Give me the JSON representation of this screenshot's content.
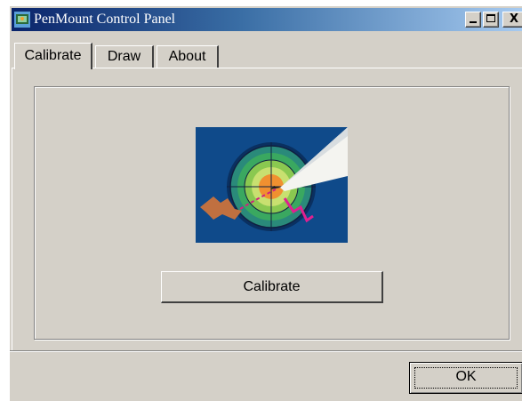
{
  "window": {
    "title": "PenMount Control Panel",
    "icon": "penmount-app-icon"
  },
  "title_buttons": {
    "minimize": "minimize-icon",
    "maximize": "maximize-icon",
    "close": "X"
  },
  "tabs": [
    {
      "label": "Calibrate",
      "active": true
    },
    {
      "label": "Draw",
      "active": false
    },
    {
      "label": "About",
      "active": false
    }
  ],
  "calibrate_panel": {
    "illustration": "target-calibration-icon",
    "button_label": "Calibrate"
  },
  "footer": {
    "ok_label": "OK"
  },
  "colors": {
    "titlebar_start": "#0a246a",
    "titlebar_end": "#a6caf0",
    "face": "#d4d0c8",
    "illustration_bg": "#0f4a8a"
  }
}
